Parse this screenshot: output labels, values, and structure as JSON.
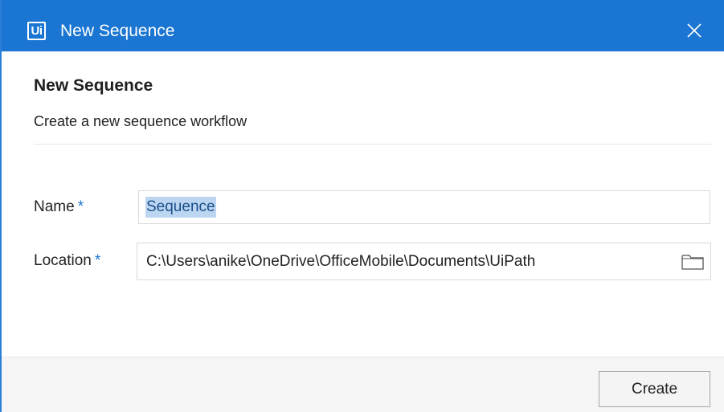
{
  "window": {
    "title": "New Sequence",
    "logo_text": "Ui",
    "close_icon": "close-icon",
    "accent_color": "#1a76d2"
  },
  "header": {
    "title": "New Sequence",
    "description": "Create a new sequence workflow"
  },
  "form": {
    "name": {
      "label": "Name",
      "required_marker": "*",
      "value": "Sequence"
    },
    "location": {
      "label": "Location",
      "required_marker": "*",
      "value": "C:\\Users\\anike\\OneDrive\\OfficeMobile\\Documents\\UiPath",
      "browse_icon": "folder-icon"
    }
  },
  "footer": {
    "create_label": "Create"
  }
}
